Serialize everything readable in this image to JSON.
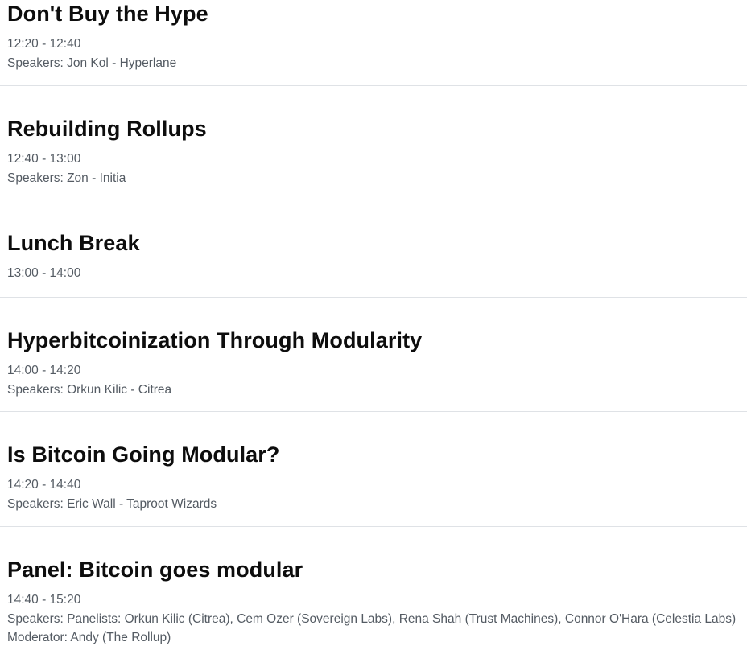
{
  "sessions": [
    {
      "title": "Don't Buy the Hype",
      "time": "12:20 - 12:40",
      "speakers": "Speakers: Jon Kol - Hyperlane"
    },
    {
      "title": "Rebuilding Rollups",
      "time": "12:40 - 13:00",
      "speakers": "Speakers: Zon - Initia"
    },
    {
      "title": "Lunch Break",
      "time": "13:00 - 14:00",
      "speakers": ""
    },
    {
      "title": "Hyperbitcoinization Through Modularity",
      "time": "14:00 - 14:20",
      "speakers": "Speakers: Orkun Kilic - Citrea"
    },
    {
      "title": "Is Bitcoin Going Modular?",
      "time": "14:20 - 14:40",
      "speakers": "Speakers: Eric Wall - Taproot Wizards"
    },
    {
      "title": "Panel: Bitcoin goes modular",
      "time": "14:40 - 15:20",
      "speakers": "Speakers: Panelists: Orkun Kilic (Citrea), Cem Ozer (Sovereign Labs), Rena Shah (Trust Machines), Connor O'Hara (Celestia Labs) Moderator: Andy (The Rollup)"
    }
  ]
}
